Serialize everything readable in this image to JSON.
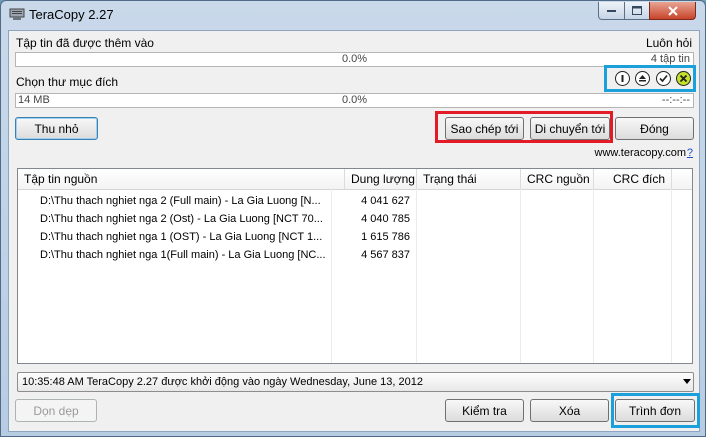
{
  "window": {
    "title": "TeraCopy 2.27"
  },
  "source": {
    "label": "Tập tin đã được thêm vào",
    "mode": "Luôn hỏi",
    "progress": "0.0%",
    "count": "4 tập tin"
  },
  "target": {
    "label": "Chọn thư mục đích",
    "size": "14 MB",
    "progress": "0.0%",
    "time": "--:--:--"
  },
  "buttons": {
    "minimize": "Thu nhỏ",
    "copy_to": "Sao chép tới",
    "move_to": "Di chuyển tới",
    "close": "Đóng",
    "clear": "Dọn dẹp",
    "verify": "Kiểm tra",
    "delete": "Xóa",
    "menu": "Trình đơn"
  },
  "link": "www.teracopy.com",
  "link_suffix": "?",
  "table": {
    "columns": [
      "Tập tin nguồn",
      "Dung lượng",
      "Trạng thái",
      "CRC nguồn",
      "CRC đích"
    ],
    "rows": [
      {
        "name": "D:\\Thu thach nghiet nga 2 (Full main) - La Gia Luong [N...",
        "size": "4 041 627"
      },
      {
        "name": "D:\\Thu thach nghiet nga 2 (Ost) - La Gia Luong [NCT 70...",
        "size": "4 040 785"
      },
      {
        "name": "D:\\Thu thach nghiet nga 1 (OST) - La Gia Luong [NCT 1...",
        "size": "1 615 786"
      },
      {
        "name": "D:\\Thu thach nghiet nga 1(Full main) - La Gia Luong [NC...",
        "size": "4 567 837"
      }
    ]
  },
  "status": "10:35:48 AM TeraCopy 2.27 được khởi động vào ngày Wednesday, June 13, 2012",
  "icons": [
    "info-icon",
    "eject-icon",
    "check-icon",
    "cancel-icon"
  ],
  "colors": {
    "highlight_red": "#e21b26",
    "highlight_blue": "#1aa0db",
    "cancel_green": "#c6e02c"
  }
}
